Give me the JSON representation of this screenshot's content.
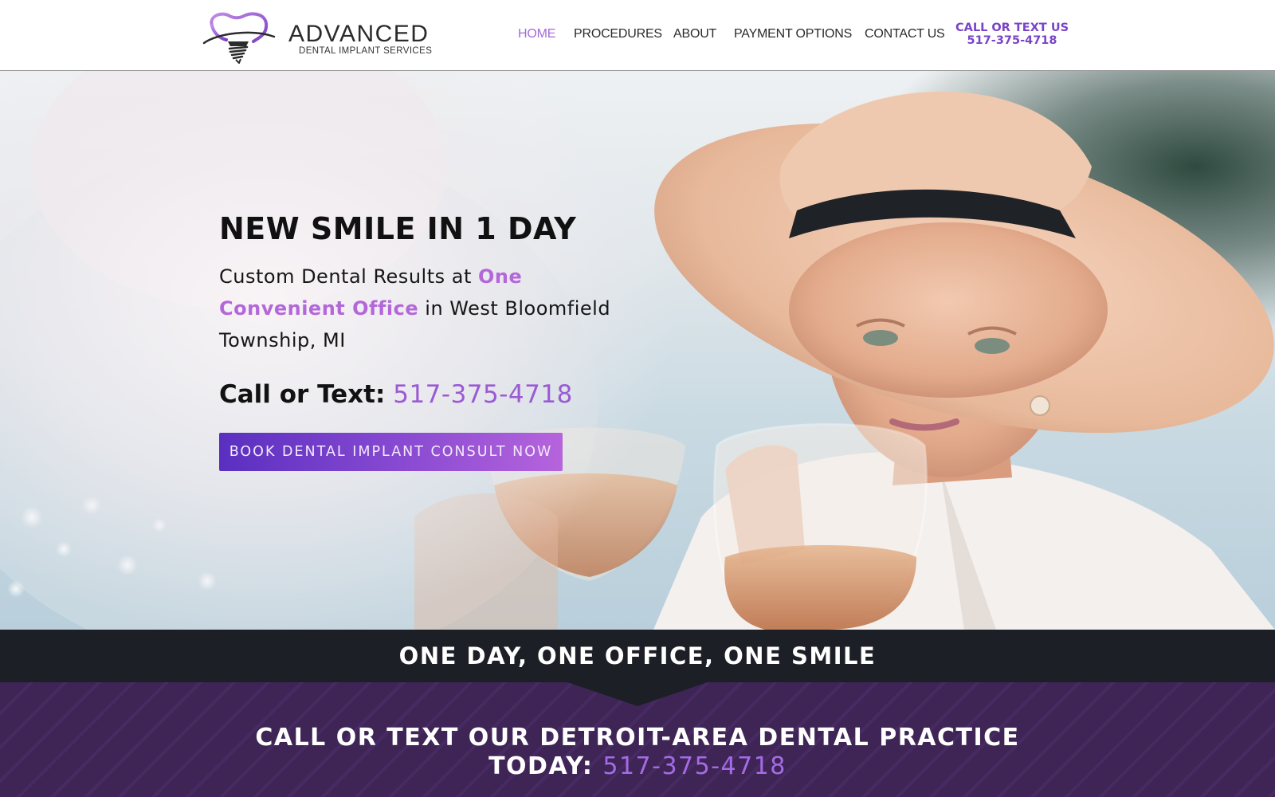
{
  "brand": {
    "name": "ADVANCED",
    "subtitle": "DENTAL IMPLANT SERVICES",
    "accent_color": "#9a5ad3"
  },
  "nav": {
    "items": [
      {
        "label": "HOME",
        "active": true
      },
      {
        "label": "PROCEDURES",
        "active": false
      },
      {
        "label": "ABOUT",
        "active": false
      },
      {
        "label": "PAYMENT OPTIONS",
        "active": false
      },
      {
        "label": "CONTACT US",
        "active": false
      }
    ],
    "cta_line1": "CALL OR TEXT US",
    "cta_line2": "517-375-4718"
  },
  "hero": {
    "title": "NEW SMILE IN 1 DAY",
    "desc_pre": "Custom Dental Results at ",
    "desc_highlight": "One Convenient Office",
    "desc_post": " in West Bloomfield Township, MI",
    "call_label": "Call or Text:",
    "call_number": "517-375-4718",
    "button_label": "BOOK DENTAL IMPLANT CONSULT NOW"
  },
  "banner": {
    "text": "ONE DAY, ONE OFFICE, ONE SMILE"
  },
  "cta_strip": {
    "line1": "CALL OR TEXT OUR DETROIT-AREA DENTAL PRACTICE",
    "today_label": "TODAY:",
    "number": "517-375-4718"
  }
}
